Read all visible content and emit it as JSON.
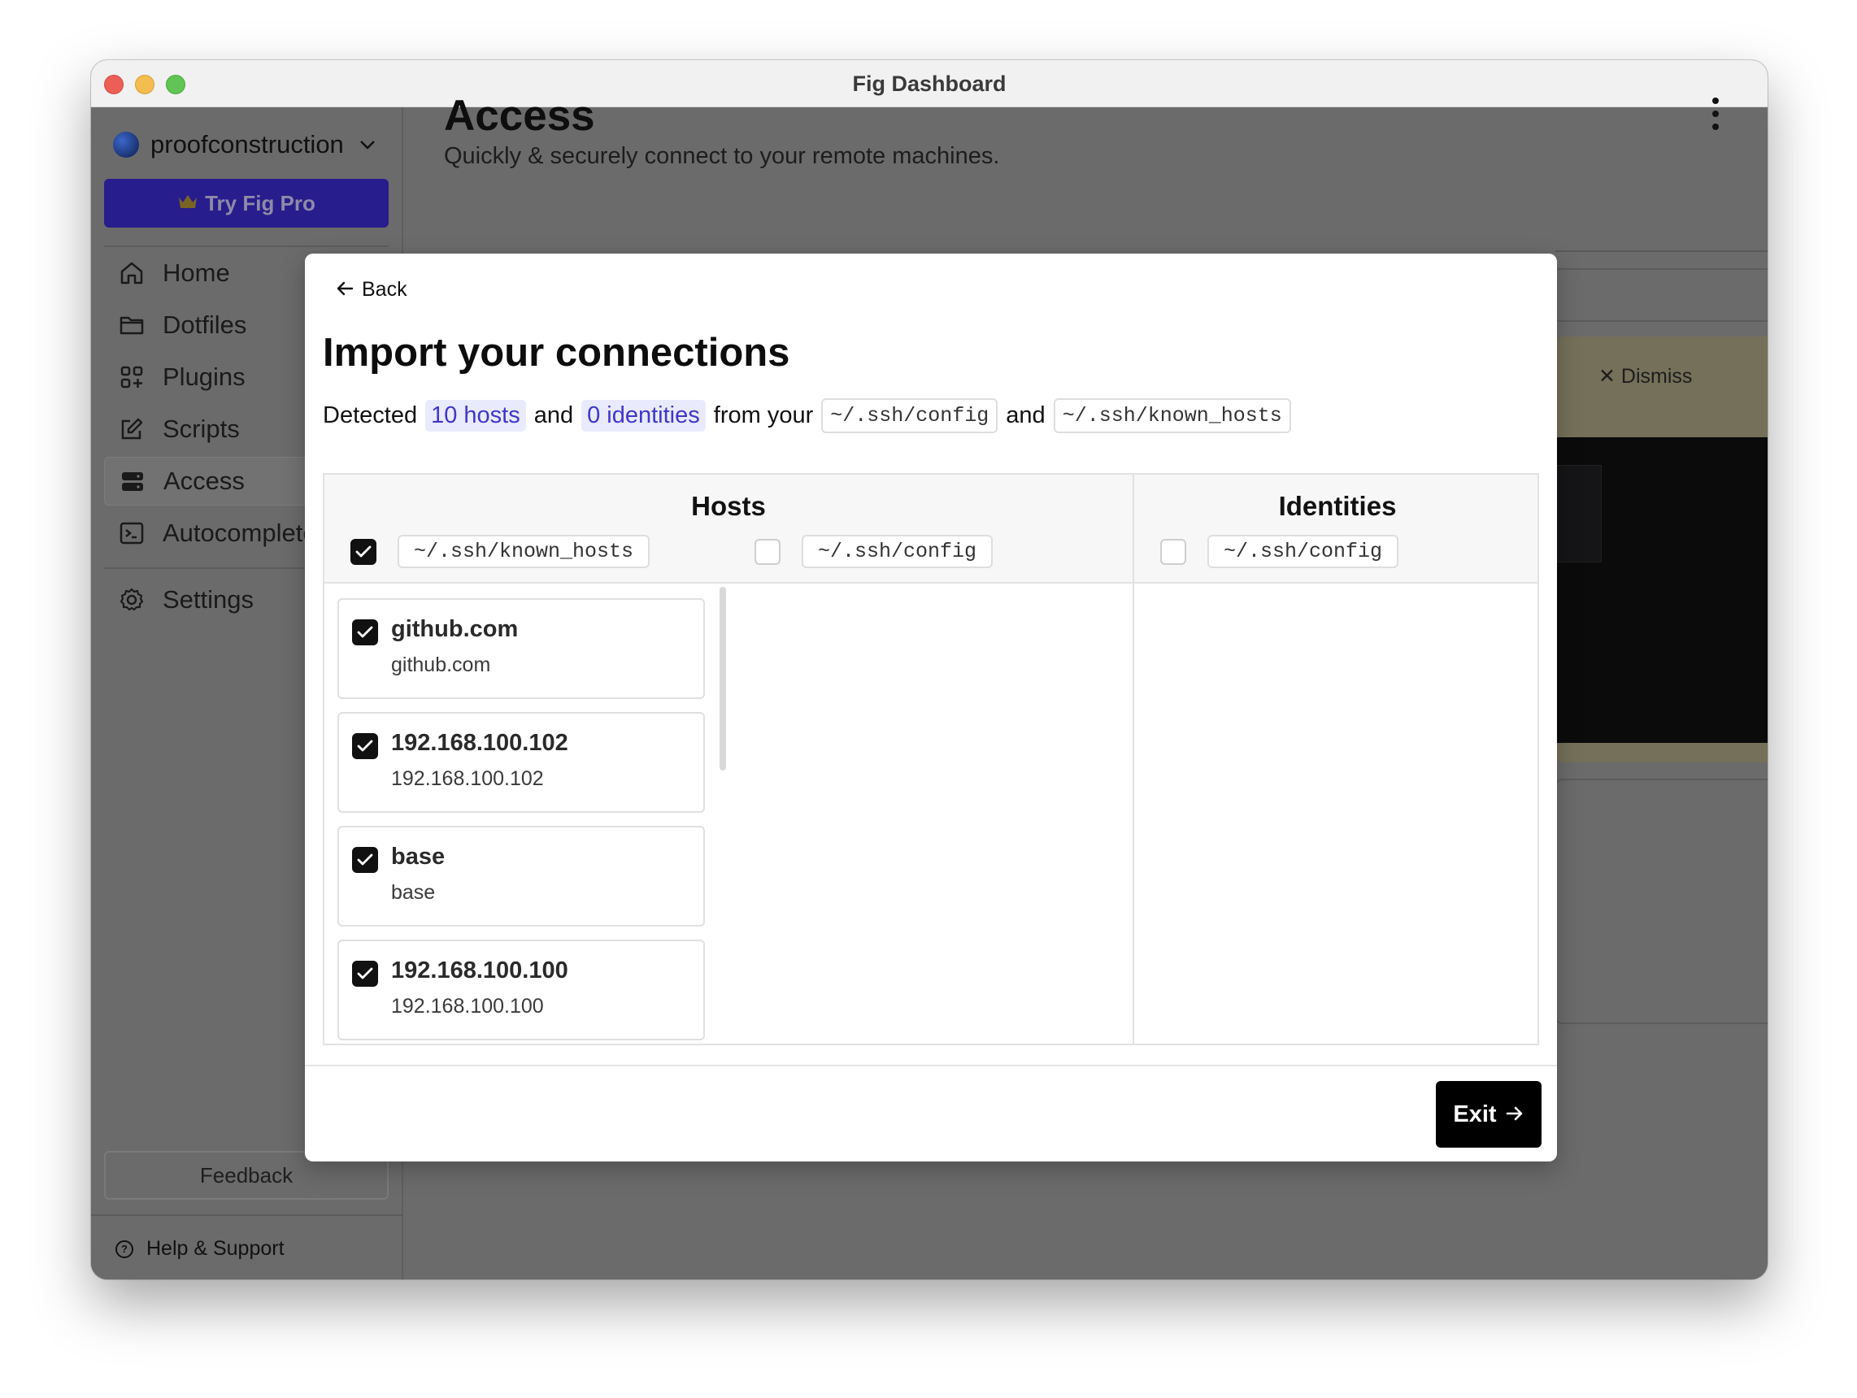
{
  "window": {
    "title": "Fig Dashboard"
  },
  "sidebar": {
    "workspace": "proofconstruction",
    "try_pro": "Try Fig Pro",
    "items": [
      {
        "label": "Home",
        "icon": "home-icon"
      },
      {
        "label": "Dotfiles",
        "icon": "folder-icon"
      },
      {
        "label": "Plugins",
        "icon": "plugins-icon"
      },
      {
        "label": "Scripts",
        "icon": "edit-icon"
      },
      {
        "label": "Access",
        "icon": "server-icon"
      },
      {
        "label": "Autocomplete",
        "icon": "terminal-icon"
      },
      {
        "label": "Settings",
        "icon": "gear-icon"
      }
    ],
    "feedback": "Feedback",
    "help": "Help & Support"
  },
  "main": {
    "title": "Access",
    "subtitle": "Quickly & securely connect to your remote machines.",
    "shortcut": "/",
    "dismiss": "Dismiss"
  },
  "modal": {
    "back": "Back",
    "title": "Import your connections",
    "detected": {
      "prefix": "Detected",
      "hosts": "10 hosts",
      "and1": "and",
      "identities": "0 identities",
      "from": "from your",
      "file1": "~/.ssh/config",
      "and2": "and",
      "file2": "~/.ssh/known_hosts"
    },
    "hosts_title": "Hosts",
    "identities_title": "Identities",
    "filters": [
      {
        "label": "~/.ssh/known_hosts",
        "checked": true
      },
      {
        "label": "~/.ssh/config",
        "checked": false
      },
      {
        "label": "~/.ssh/config",
        "checked": false
      }
    ],
    "hosts": [
      {
        "name": "github.com",
        "address": "github.com",
        "checked": true
      },
      {
        "name": "192.168.100.102",
        "address": "192.168.100.102",
        "checked": true
      },
      {
        "name": "base",
        "address": "base",
        "checked": true
      },
      {
        "name": "192.168.100.100",
        "address": "192.168.100.100",
        "checked": true
      }
    ],
    "exit": "Exit"
  }
}
